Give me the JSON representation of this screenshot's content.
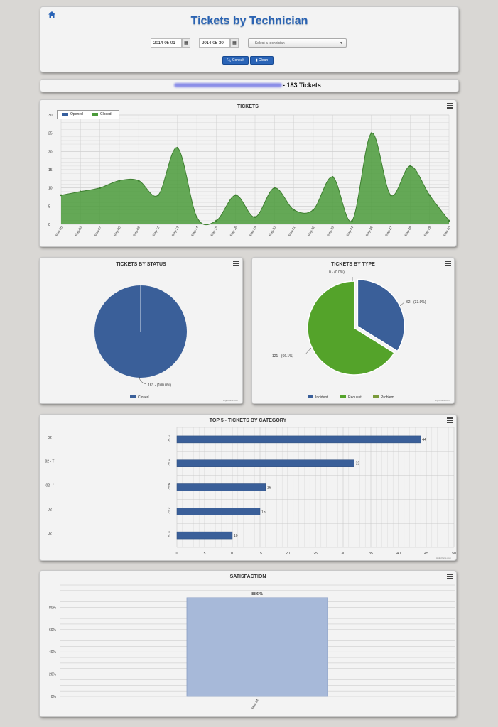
{
  "header": {
    "title": "Tickets by Technician",
    "date_from": "2014-05-01",
    "date_to": "2014-05-30",
    "technician_placeholder": "-- Select a technician --",
    "consult_label": "Consult",
    "clean_label": "Clean"
  },
  "summary": {
    "text": "- 183 Tickets"
  },
  "tickets_chart": {
    "title": "TICKETS",
    "legend": [
      "Opened",
      "Closed"
    ],
    "chart_data": {
      "type": "area",
      "title": "TICKETS",
      "categories": [
        "May-05",
        "May-06",
        "May-07",
        "May-08",
        "May-09",
        "May-12",
        "May-13",
        "May-14",
        "May-15",
        "May-16",
        "May-19",
        "May-20",
        "May-21",
        "May-22",
        "May-23",
        "May-24",
        "May-26",
        "May-27",
        "May-28",
        "May-29",
        "May-30"
      ],
      "series": [
        {
          "name": "Opened",
          "values": []
        },
        {
          "name": "Closed",
          "values": [
            8,
            9,
            10,
            12,
            12,
            8,
            21,
            2,
            1,
            8,
            2,
            10,
            4,
            4,
            13,
            1,
            25,
            8,
            16,
            8,
            1
          ]
        }
      ],
      "ylim": [
        0,
        30
      ],
      "yticks": [
        0,
        5,
        10,
        15,
        20,
        25,
        30
      ],
      "grid": true,
      "legend_position": "top-left",
      "colors": {
        "Opened": "#365f9e",
        "Closed": "#4a9a3a"
      }
    }
  },
  "status_chart": {
    "title": "TICKETS BY STATUS",
    "legend": [
      "Closed"
    ],
    "credit": "Highcharts.com",
    "chart_data": {
      "type": "pie",
      "title": "TICKETS BY STATUS",
      "slices": [
        {
          "label": "Closed",
          "value": 183,
          "display": "183 - (100.0%)",
          "color": "#3a5f99"
        }
      ]
    }
  },
  "type_chart": {
    "title": "TICKETS BY TYPE",
    "legend": [
      "Incident",
      "Request",
      "Problem"
    ],
    "credit": "Highcharts.com",
    "chart_data": {
      "type": "pie",
      "title": "TICKETS BY TYPE",
      "slices": [
        {
          "label": "Incident",
          "value": 62,
          "display": "62 - (33.9%)",
          "color": "#3a5f99"
        },
        {
          "label": "Request",
          "value": 121,
          "display": "121 - (66.1%)",
          "color": "#54a32a"
        },
        {
          "label": "Problem",
          "value": 0,
          "display": "0 - (0.0%)",
          "color": "#7a9a3a"
        }
      ]
    }
  },
  "category_chart": {
    "title": "TOP 5 - TICKETS BY CATEGORY",
    "credit": "Highcharts.com",
    "left_labels": [
      "02",
      "02 - T",
      "02 - '",
      "02",
      "02"
    ],
    "mid_labels": [
      ">\n3)",
      ">\n8)",
      "w\n3)",
      ">\n2)",
      ">\n5)"
    ],
    "chart_data": {
      "type": "bar",
      "title": "TOP 5 - TICKETS BY CATEGORY",
      "values": [
        44,
        32,
        16,
        15,
        10
      ],
      "xlim": [
        0,
        50
      ],
      "xticks": [
        0,
        5,
        10,
        15,
        20,
        25,
        30,
        35,
        40,
        45,
        50
      ],
      "color": "#3a5f99"
    }
  },
  "satisfaction_chart": {
    "title": "SATISFACTION",
    "chart_data": {
      "type": "bar",
      "title": "SATISFACTION",
      "categories": [
        "May-14"
      ],
      "values": [
        88.6
      ],
      "value_label": "88.6 %",
      "ylim": [
        0,
        100
      ],
      "yticks": [
        "0%",
        "20%",
        "40%",
        "60%",
        "80%"
      ],
      "color": "#a7b9d9"
    }
  }
}
